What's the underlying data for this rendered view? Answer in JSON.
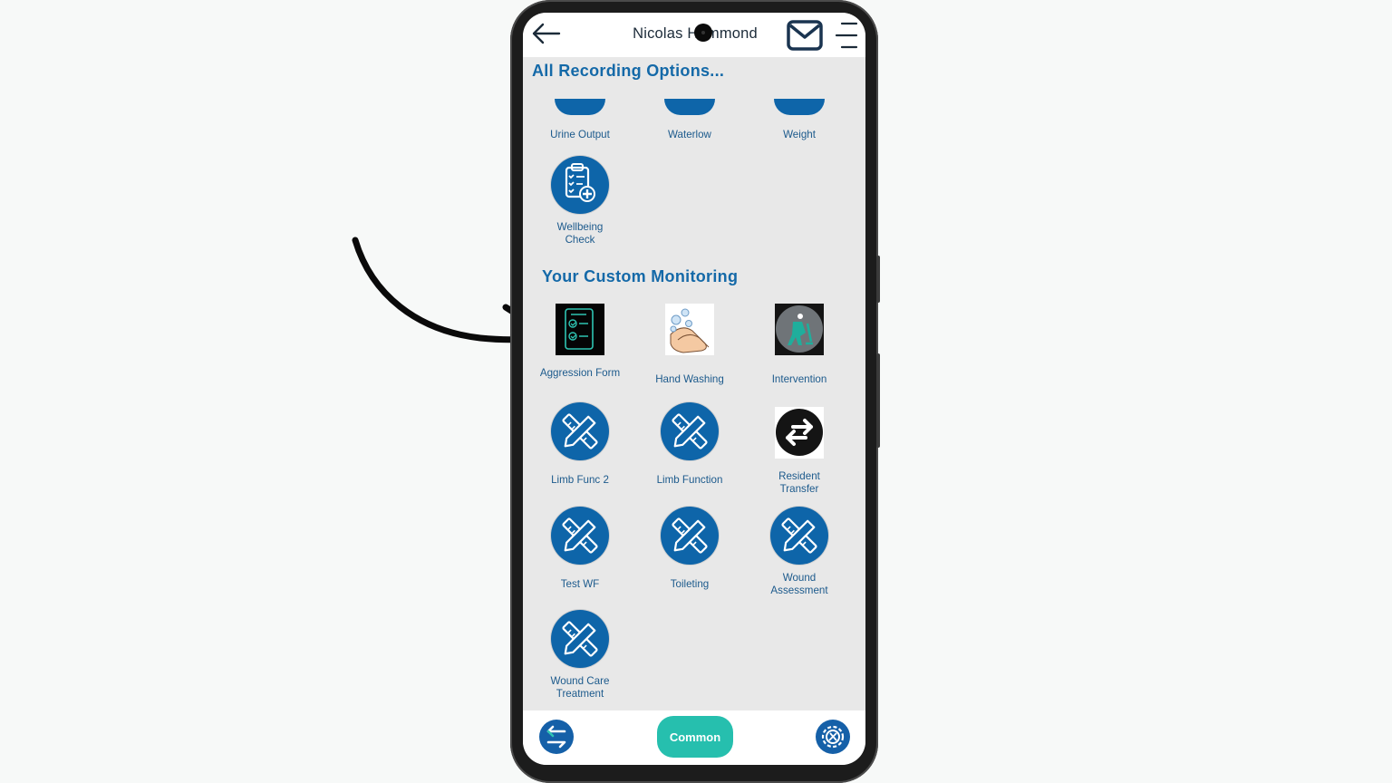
{
  "header": {
    "title": "Nicolas Hammond",
    "back_icon": "arrow-left-icon",
    "mail_icon": "envelope-icon",
    "menu_icon": "hamburger-menu-icon"
  },
  "sections": {
    "recording_title": "All Recording Options...",
    "custom_title": "Your Custom Monitoring"
  },
  "recording_items": [
    {
      "label": "Urine Output",
      "icon": "blue-circle-icon"
    },
    {
      "label": "Waterlow",
      "icon": "blue-circle-icon"
    },
    {
      "label": "Weight",
      "icon": "blue-circle-icon"
    },
    {
      "label": "Wellbeing Check",
      "icon": "clipboard-medical-icon"
    }
  ],
  "custom_items": [
    {
      "label": "Aggression Form",
      "icon": "checklist-form-icon"
    },
    {
      "label": "Hand Washing",
      "icon": "hand-washing-icon"
    },
    {
      "label": "Intervention",
      "icon": "intervention-figure-icon"
    },
    {
      "label": "Limb Func 2",
      "icon": "pencil-ruler-icon"
    },
    {
      "label": "Limb Function",
      "icon": "pencil-ruler-icon"
    },
    {
      "label": "Resident Transfer",
      "icon": "transfer-arrows-icon"
    },
    {
      "label": "Test WF",
      "icon": "pencil-ruler-icon"
    },
    {
      "label": "Toileting",
      "icon": "pencil-ruler-icon"
    },
    {
      "label": "Wound Assessment",
      "icon": "pencil-ruler-icon"
    },
    {
      "label": "Wound Care Treatment",
      "icon": "pencil-ruler-icon"
    }
  ],
  "bottom_bar": {
    "common_label": "Common",
    "left_icon": "swap-arrows-icon",
    "right_icon": "settings-gear-icon"
  },
  "colors": {
    "primary_blue": "#0e65a9",
    "heading_blue": "#1469a8",
    "teal": "#26bfae",
    "screen_bg": "#e8e8e8"
  }
}
